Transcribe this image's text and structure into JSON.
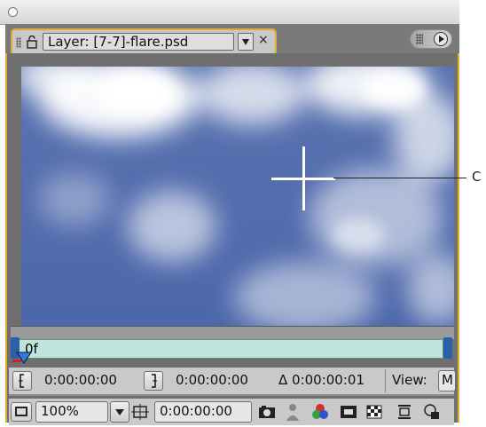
{
  "window": {
    "close_icon": "circle-close-icon"
  },
  "tab": {
    "title": "Layer: [7-7]-flare.psd",
    "close_label": "×",
    "lock_icon": "lock-icon",
    "dropdown_icon": "triangle-down-icon"
  },
  "panel_menu": {
    "icon": "panel-menu-arrow-icon"
  },
  "viewer": {
    "annotation_label": "C"
  },
  "timeline": {
    "current_time_label": "0f",
    "accent": "#e4a92f"
  },
  "controls": {
    "in_point": "0:00:00:00",
    "out_point": "0:00:00:00",
    "duration": "Δ 0:00:00:01",
    "view_label": "View:",
    "view_value": "M"
  },
  "footer": {
    "zoom_value": "100%",
    "current_time": "0:00:00:00",
    "icons": [
      "always-preview-icon",
      "resolution-icon",
      "snapshot-icon",
      "show-snapshot-icon",
      "channel-icon",
      "region-icon",
      "transparency-grid-icon",
      "comp-flowchart-icon",
      "pixel-aspect-icon"
    ]
  }
}
